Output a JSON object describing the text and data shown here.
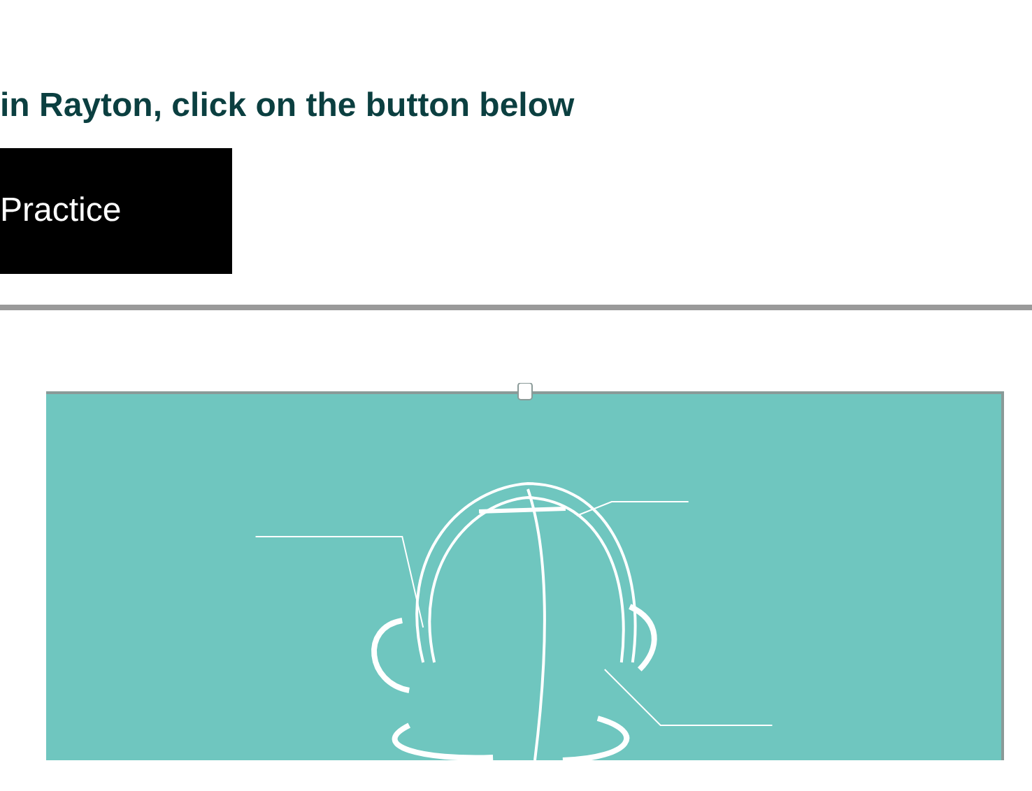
{
  "heading": "in Rayton, click on the button below",
  "button": {
    "label": "Practice"
  }
}
